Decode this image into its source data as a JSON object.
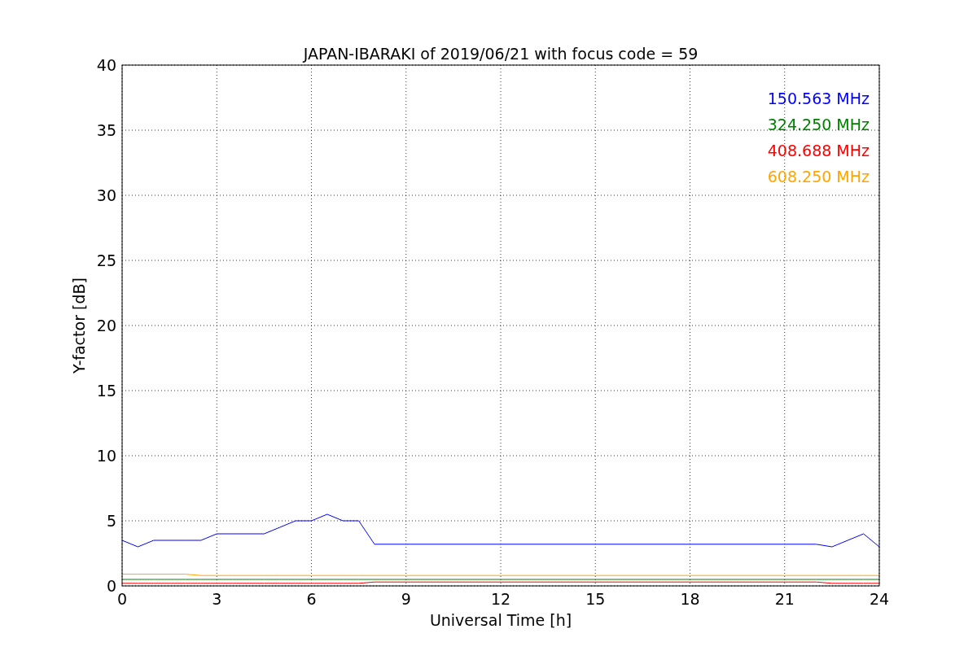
{
  "chart_data": {
    "type": "line",
    "title": "JAPAN-IBARAKI of 2019/06/21 with focus code = 59",
    "xlabel": "Universal Time [h]",
    "ylabel": "Y-factor [dB]",
    "x": [
      0,
      0.5,
      1,
      1.5,
      2,
      2.5,
      3,
      3.5,
      4,
      4.5,
      5,
      5.5,
      6,
      6.5,
      7,
      7.5,
      8,
      22,
      22.5,
      23,
      23.5,
      24
    ],
    "series": [
      {
        "name": "150.563 MHz",
        "color": "#0000ff",
        "values": [
          3.5,
          3.0,
          3.5,
          3.5,
          3.5,
          3.5,
          4.0,
          4.0,
          4.0,
          4.0,
          4.5,
          5.0,
          5.0,
          5.5,
          5.0,
          5.0,
          3.2,
          3.2,
          3.0,
          3.5,
          4.0,
          3.0
        ]
      },
      {
        "name": "324.250 MHz",
        "color": "#008000",
        "values": [
          0.5,
          0.5,
          0.5,
          0.5,
          0.5,
          0.5,
          0.5,
          0.5,
          0.5,
          0.5,
          0.5,
          0.5,
          0.5,
          0.5,
          0.5,
          0.5,
          0.5,
          0.5,
          0.5,
          0.5,
          0.5,
          0.5
        ]
      },
      {
        "name": "408.688 MHz",
        "color": "#ff0000",
        "values": [
          0.2,
          0.2,
          0.2,
          0.2,
          0.2,
          0.2,
          0.2,
          0.2,
          0.2,
          0.2,
          0.2,
          0.2,
          0.2,
          0.2,
          0.2,
          0.2,
          0.3,
          0.3,
          0.2,
          0.2,
          0.2,
          0.2
        ]
      },
      {
        "name": "608.250 MHz",
        "color": "#ffa500",
        "values": [
          0.9,
          0.9,
          0.9,
          0.9,
          0.9,
          0.8,
          0.8,
          0.8,
          0.8,
          0.8,
          0.8,
          0.8,
          0.8,
          0.8,
          0.8,
          0.8,
          0.8,
          0.8,
          0.8,
          0.8,
          0.8,
          0.8
        ]
      }
    ],
    "grid": true,
    "xlim": [
      0,
      24
    ],
    "ylim": [
      0,
      40
    ],
    "xticks": [
      0,
      3,
      6,
      9,
      12,
      15,
      18,
      21,
      24
    ],
    "yticks": [
      0,
      5,
      10,
      15,
      20,
      25,
      30,
      35,
      40
    ]
  }
}
